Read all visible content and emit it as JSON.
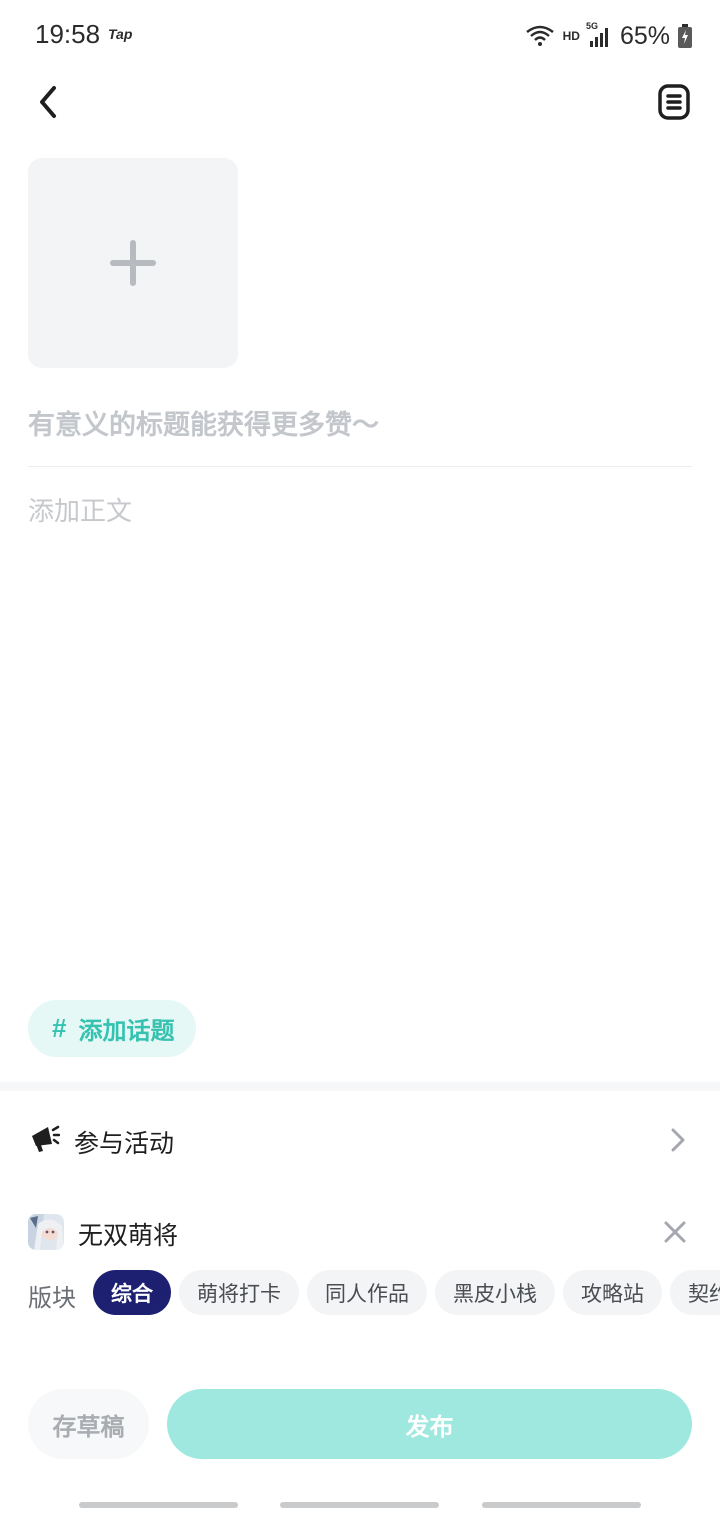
{
  "status_bar": {
    "time": "19:58",
    "app_badge": "Tap",
    "network": "HD",
    "network_gen": "5G",
    "battery": "65%"
  },
  "nav": {
    "back_icon": "chevron-left-icon",
    "drafts_icon": "document-list-icon"
  },
  "editor": {
    "add_image_icon": "plus-icon",
    "title_placeholder": "有意义的标题能获得更多赞～",
    "body_placeholder": "添加正文"
  },
  "topic": {
    "hash": "#",
    "label": "添加话题"
  },
  "activity": {
    "icon": "megaphone-icon",
    "label": "参与活动"
  },
  "game": {
    "name": "无双萌将"
  },
  "sections": {
    "label": "版块",
    "tags": [
      "综合",
      "萌将打卡",
      "同人作品",
      "黑皮小栈",
      "攻略站",
      "契约"
    ],
    "selected": "综合"
  },
  "actions": {
    "save_draft": "存草稿",
    "publish": "发布"
  },
  "colors": {
    "accent": "#35c2b0",
    "publish_bg": "#9ee8df",
    "tag_active": "#1d2070"
  }
}
